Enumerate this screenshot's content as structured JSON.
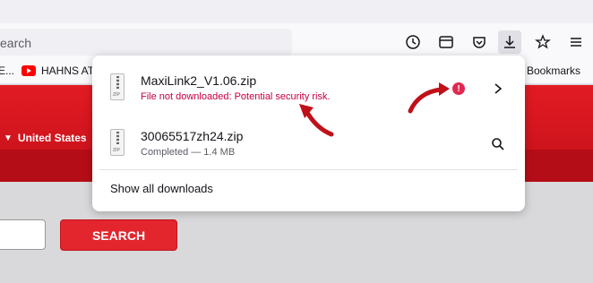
{
  "toolbar": {
    "url_placeholder": "earch"
  },
  "bookmarks": {
    "items": [
      {
        "label": "E..."
      },
      {
        "label": "HAHNS AT"
      }
    ],
    "other_label": "er Bookmarks"
  },
  "page": {
    "country_label": "United States",
    "separator": "|",
    "search_button": "SEARCH"
  },
  "downloads": {
    "items": [
      {
        "filename": "MaxiLink2_V1.06.zip",
        "status": "File not downloaded: Potential security risk.",
        "badge": "!"
      },
      {
        "filename": "30065517zh24.zip",
        "status": "Completed — 1.4 MB"
      }
    ],
    "show_all": "Show all downloads"
  },
  "colors": {
    "danger": "#c50042",
    "brand_red": "#e21b23",
    "warn_badge": "#e22850"
  }
}
